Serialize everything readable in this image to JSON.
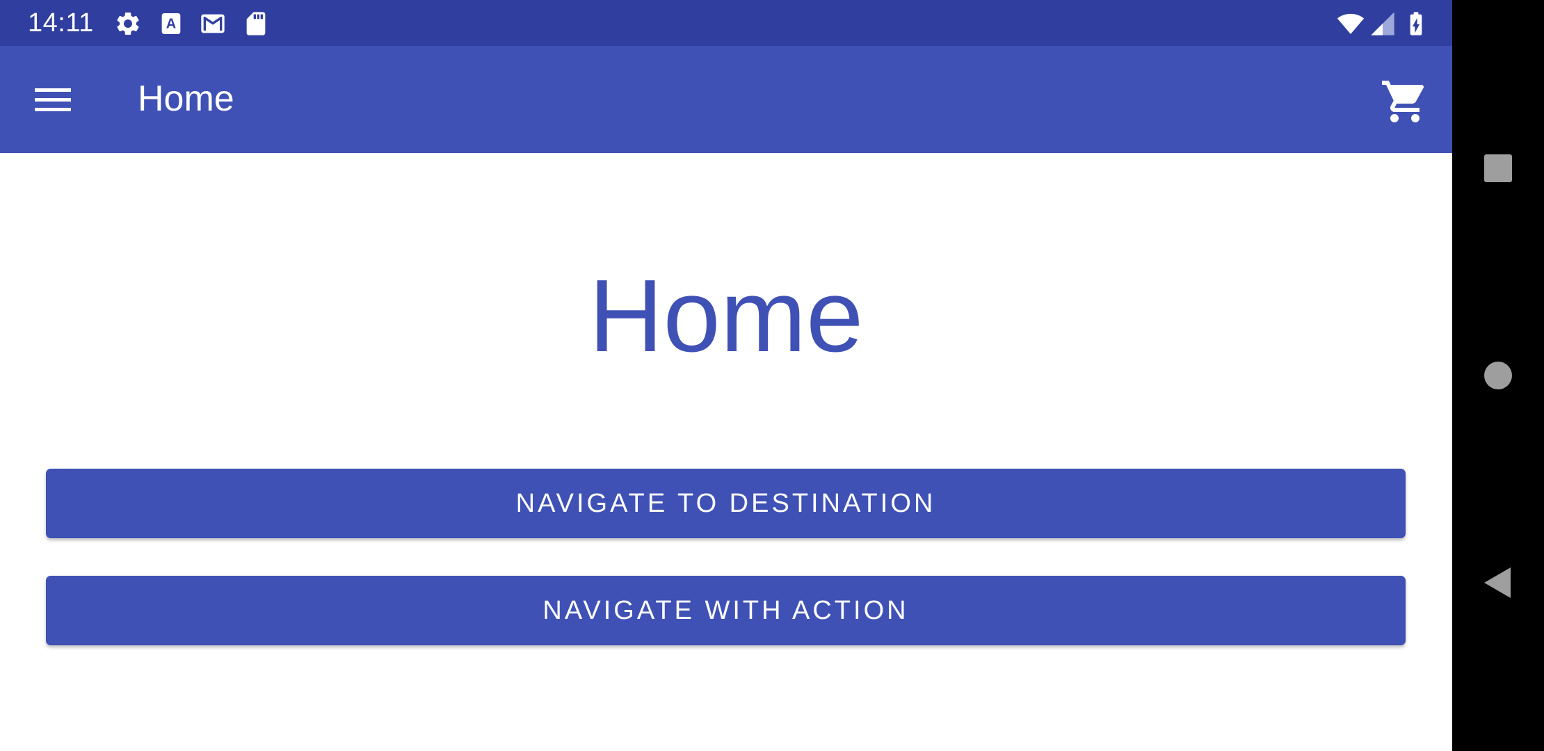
{
  "status_bar": {
    "time": "14:11",
    "icons_left": [
      "settings-icon",
      "font-a-icon",
      "gmail-icon",
      "sd-card-icon"
    ],
    "icons_right": [
      "wifi-icon",
      "signal-icon",
      "battery-charging-icon"
    ],
    "background": "#303f9f"
  },
  "app_bar": {
    "menu_icon": "hamburger-menu-icon",
    "title": "Home",
    "action_icon": "shopping-cart-icon",
    "background": "#3f51b5"
  },
  "main": {
    "heading": "Home",
    "buttons": [
      {
        "label": "NAVIGATE TO DESTINATION"
      },
      {
        "label": "NAVIGATE WITH ACTION"
      }
    ],
    "accent": "#3f51b5"
  },
  "system_nav": {
    "recents_icon": "square-recents-icon",
    "home_icon": "circle-home-icon",
    "back_icon": "triangle-back-icon"
  }
}
